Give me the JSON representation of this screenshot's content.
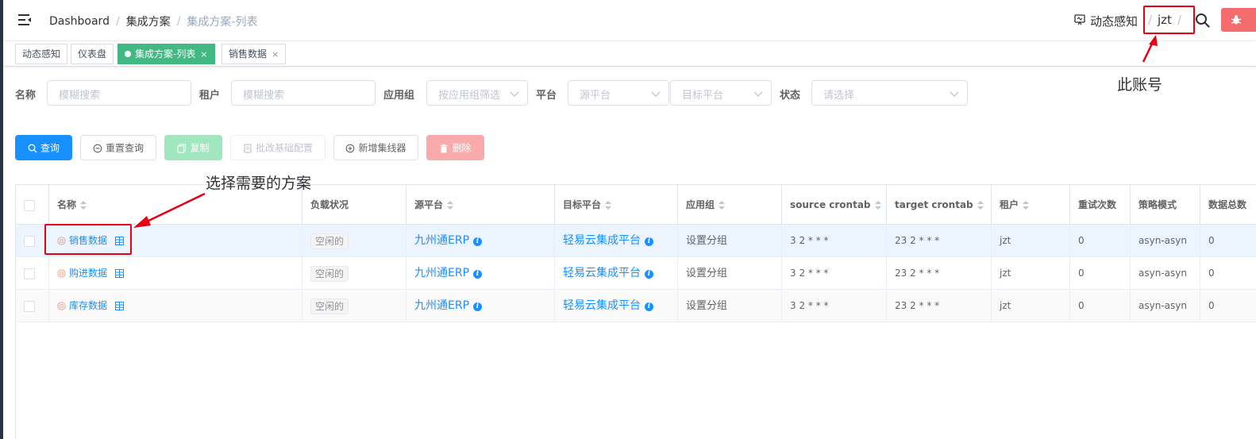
{
  "colors": {
    "primary": "#1890ff",
    "success_tag": "#42b983",
    "danger": "#f56c6c",
    "annotation_red": "#e60012",
    "sidebar_dark": "#263445"
  },
  "topbar": {
    "hamburger_icon": "hamburger-icon",
    "breadcrumb": [
      "Dashboard",
      "集成方案",
      "集成方案-列表"
    ],
    "right_menu": {
      "notify_label": "动态感知",
      "notify_icon": "monitor-icon",
      "account": "jzt",
      "sep": "/",
      "search_icon": "search-icon",
      "bug_icon": "bug-icon"
    }
  },
  "tags": [
    {
      "label": "动态感知",
      "active": false,
      "closable": false
    },
    {
      "label": "仪表盘",
      "active": false,
      "closable": false
    },
    {
      "label": "集成方案-列表",
      "active": true,
      "closable": true
    },
    {
      "label": "销售数据",
      "active": false,
      "closable": true
    }
  ],
  "tag_close": "×",
  "filters": {
    "name_label": "名称",
    "name_placeholder": "模糊搜索",
    "tenant_label": "租户",
    "tenant_placeholder": "模糊搜索",
    "appgroup_label": "应用组",
    "appgroup_placeholder": "按应用组筛选",
    "platform_label": "平台",
    "source_placeholder": "源平台",
    "target_placeholder": "目标平台",
    "status_label": "状态",
    "status_placeholder": "请选择"
  },
  "toolbar": {
    "query": "查询",
    "reset": "重置查询",
    "copy": "复制",
    "batch": "批改基础配置",
    "add_collector": "新增集线器",
    "delete": "删除"
  },
  "table": {
    "columns": [
      "名称",
      "负载状况",
      "源平台",
      "目标平台",
      "应用组",
      "source crontab",
      "target crontab",
      "租户",
      "重试次数",
      "策略模式",
      "数据总数"
    ],
    "rows": [
      {
        "name": "销售数据",
        "status": "空闲的",
        "source": "九州通ERP",
        "target": "轻易云集成平台",
        "group": "设置分组",
        "source_cron": "3 2 * * *",
        "target_cron": "23 2 * * *",
        "tenant": "jzt",
        "retries": "0",
        "mode": "asyn-asyn",
        "total": "0"
      },
      {
        "name": "购进数据",
        "status": "空闲的",
        "source": "九州通ERP",
        "target": "轻易云集成平台",
        "group": "设置分组",
        "source_cron": "3 2 * * *",
        "target_cron": "23 2 * * *",
        "tenant": "jzt",
        "retries": "0",
        "mode": "asyn-asyn",
        "total": "0"
      },
      {
        "name": "库存数据",
        "status": "空闲的",
        "source": "九州通ERP",
        "target": "轻易云集成平台",
        "group": "设置分组",
        "source_cron": "3 2 * * *",
        "target_cron": "23 2 * * *",
        "tenant": "jzt",
        "retries": "0",
        "mode": "asyn-asyn",
        "total": "0"
      }
    ]
  },
  "annotations": {
    "select_scheme": "选择需要的方案",
    "this_account": "此账号"
  }
}
